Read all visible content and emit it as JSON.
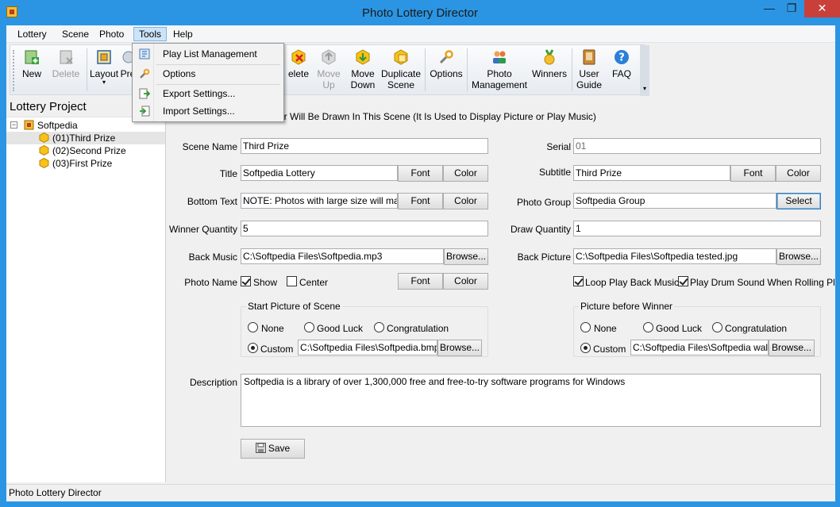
{
  "window": {
    "title": "Photo Lottery Director",
    "min": "—",
    "max": "❐",
    "close": "✕"
  },
  "menu": [
    "Lottery",
    "Scene",
    "Photo",
    "Tools",
    "Help"
  ],
  "toolbar": {
    "new": "New",
    "delete": "Delete",
    "layout": "Layout",
    "preview": "Pre",
    "delete2": "elete",
    "move_up_1": "Move",
    "move_up_2": "Up",
    "move_down_1": "Move",
    "move_down_2": "Down",
    "duplicate_1": "Duplicate",
    "duplicate_2": "Scene",
    "options": "Options",
    "photo_mgmt_1": "Photo",
    "photo_mgmt_2": "Management",
    "winners": "Winners",
    "guide_1": "User",
    "guide_2": "Guide",
    "faq": "FAQ"
  },
  "tools_menu": {
    "play_list": "Play List Management",
    "options": "Options",
    "export": "Export Settings...",
    "import": "Import Settings..."
  },
  "left": {
    "header": "Lottery Project",
    "root": "Softpedia",
    "items": [
      "(01)Third Prize",
      "(02)Second Prize",
      "(03)First Prize"
    ]
  },
  "form": {
    "hint": "er Will Be Drawn In This Scene  (It Is Used to Display Picture or Play Music)",
    "scene_name_label": "Scene Name",
    "scene_name": "Third Prize",
    "serial_label": "Serial",
    "serial": "01",
    "title_label": "Title",
    "title": "Softpedia Lottery",
    "subtitle_label": "Subtitle",
    "subtitle": "Third Prize",
    "font": "Font",
    "color": "Color",
    "bottom_label": "Bottom Text",
    "bottom": "NOTE: Photos with large size will make p",
    "group_label": "Photo Group",
    "group": "Softpedia Group",
    "select": "Select",
    "winner_qty_label": "Winner Quantity",
    "winner_qty": "5",
    "draw_qty_label": "Draw Quantity",
    "draw_qty": "1",
    "music_label": "Back Music",
    "music": "C:\\Softpedia Files\\Softpedia.mp3",
    "browse": "Browse...",
    "picture_label": "Back Picture",
    "picture": "C:\\Softpedia Files\\Softpedia tested.jpg",
    "photo_name_label": "Photo Name",
    "show": "Show",
    "center": "Center",
    "loop": "Loop Play Back Music",
    "drum": "Play Drum Sound When Rolling Photos",
    "start_group": "Start Picture of Scene",
    "winner_group": "Picture before Winner",
    "none": "None",
    "good_luck": "Good Luck",
    "congrats": "Congratulation",
    "custom": "Custom",
    "start_custom": "C:\\Softpedia Files\\Softpedia.bmp",
    "winner_custom": "C:\\Softpedia Files\\Softpedia wallpaper",
    "desc_label": "Description",
    "desc": "Softpedia is a library of over 1,300,000 free and free-to-try software programs for Windows",
    "save": "Save"
  },
  "status": "Photo Lottery Director"
}
